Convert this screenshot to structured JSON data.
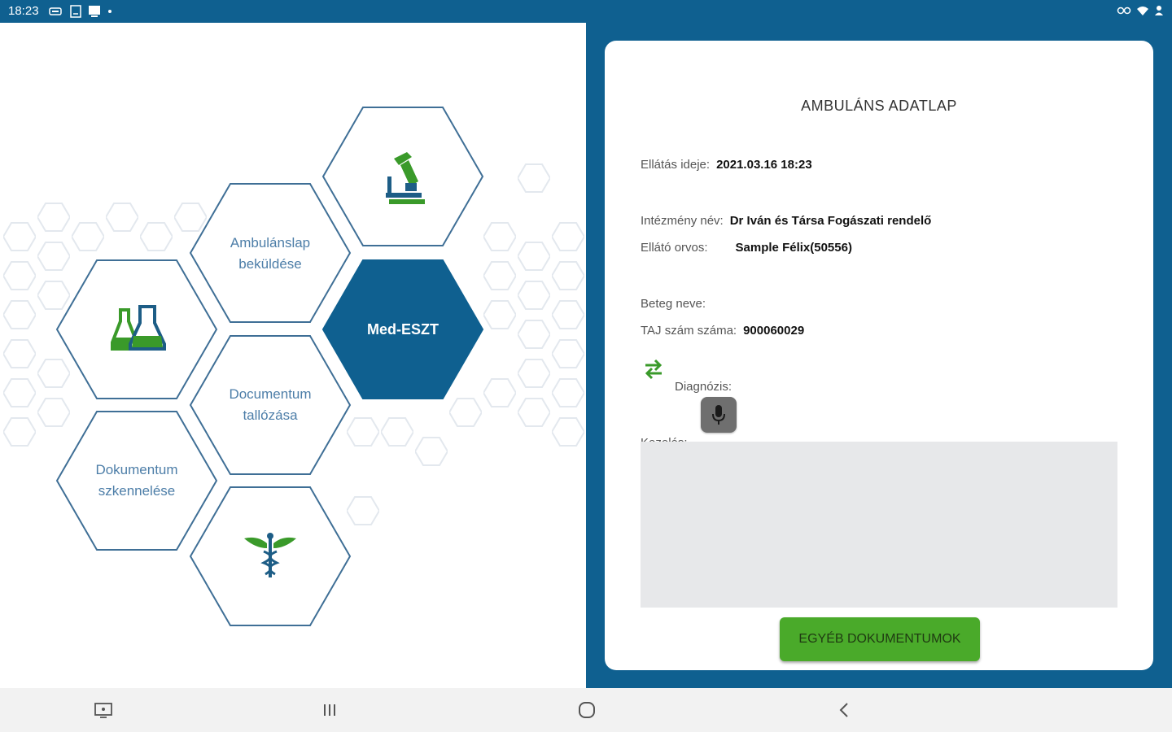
{
  "status_bar": {
    "time": "18:23",
    "left_icons": [
      "battery-saver-icon",
      "screenshot-icon",
      "cast-icon",
      "dot-icon"
    ],
    "right_icons": [
      "vpn-icon",
      "wifi-icon",
      "account-icon"
    ]
  },
  "menu": {
    "tiles": [
      {
        "id": "microscope",
        "icon": "microscope-icon",
        "label": ""
      },
      {
        "id": "ambulanslap",
        "label": "Ambulánslap beküldése"
      },
      {
        "id": "labor",
        "icon": "lab-flasks-icon",
        "label": ""
      },
      {
        "id": "medeszt",
        "label": "Med-ESZT",
        "active": true
      },
      {
        "id": "documentum",
        "label": "Documentum tallózása"
      },
      {
        "id": "dokumentum-scan",
        "label": "Dokumentum szkennelése"
      },
      {
        "id": "caduceus",
        "icon": "caduceus-icon",
        "label": ""
      }
    ]
  },
  "form": {
    "title": "AMBULÁNS ADATLAP",
    "ellatas_ideje": {
      "label": "Ellátás ideje:",
      "value": "2021.03.16 18:23"
    },
    "intezmeny_nev": {
      "label": "Intézmény név:",
      "value": "Dr Iván és Társa Fogászati rendelő"
    },
    "ellato_orvos": {
      "label": "Ellátó orvos:",
      "value": "Sample Félix(50556)"
    },
    "beteg_neve": {
      "label": "Beteg neve:",
      "value": ""
    },
    "taj_szam": {
      "label": "TAJ szám száma:",
      "value": "900060029"
    },
    "diagnozis": {
      "label": "Diagnózis:"
    },
    "kezeles": {
      "label": "Kezelés:",
      "value": ""
    },
    "button_label": "EGYÉB DOKUMENTUMOK"
  },
  "colors": {
    "primary": "#0f6090",
    "accent_green": "#4aaa2a",
    "hex_outline": "#3f6f96",
    "hex_bg_outline": "#e8ecf0"
  },
  "nav_bar": {
    "buttons": [
      "keyboard-switch-icon",
      "recents-icon",
      "home-icon",
      "back-icon"
    ]
  }
}
